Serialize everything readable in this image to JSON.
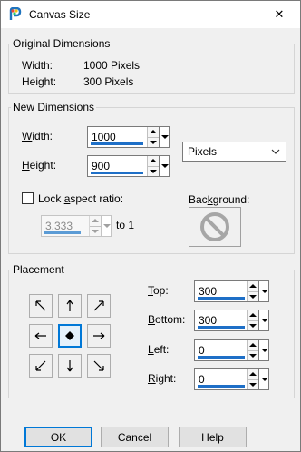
{
  "window": {
    "title": "Canvas Size",
    "close_glyph": "✕"
  },
  "original": {
    "legend": "Original Dimensions",
    "width_label": "Width:",
    "width_value": "1000 Pixels",
    "height_label": "Height:",
    "height_value": "300 Pixels"
  },
  "new_dims": {
    "legend": "New Dimensions",
    "width_label_u": "W",
    "width_label_rest": "idth:",
    "width_value": "1000",
    "height_label_u": "H",
    "height_label_rest": "eight:",
    "height_value": "900",
    "units": "Pixels",
    "lock_label_pre": "Lock ",
    "lock_label_u": "a",
    "lock_label_rest": "spect ratio:",
    "lock_checked": false,
    "ratio_value": "3,333",
    "ratio_suffix": "to 1",
    "background_label_pre": "Bac",
    "background_label_u": "k",
    "background_label_rest": "ground:"
  },
  "placement": {
    "legend": "Placement",
    "selected_anchor": "center",
    "top_label_u": "T",
    "top_label_rest": "op:",
    "top_value": "300",
    "bottom_label_u": "B",
    "bottom_label_rest": "ottom:",
    "bottom_value": "300",
    "left_label_u": "L",
    "left_label_rest": "eft:",
    "left_value": "0",
    "right_label_u": "R",
    "right_label_rest": "ight:",
    "right_value": "0"
  },
  "buttons": {
    "ok": "OK",
    "cancel": "Cancel",
    "help": "Help"
  },
  "colors": {
    "accent": "#0078d7",
    "field_bar": "#1e6fc7",
    "dialog_bg": "#f0f0f0"
  }
}
